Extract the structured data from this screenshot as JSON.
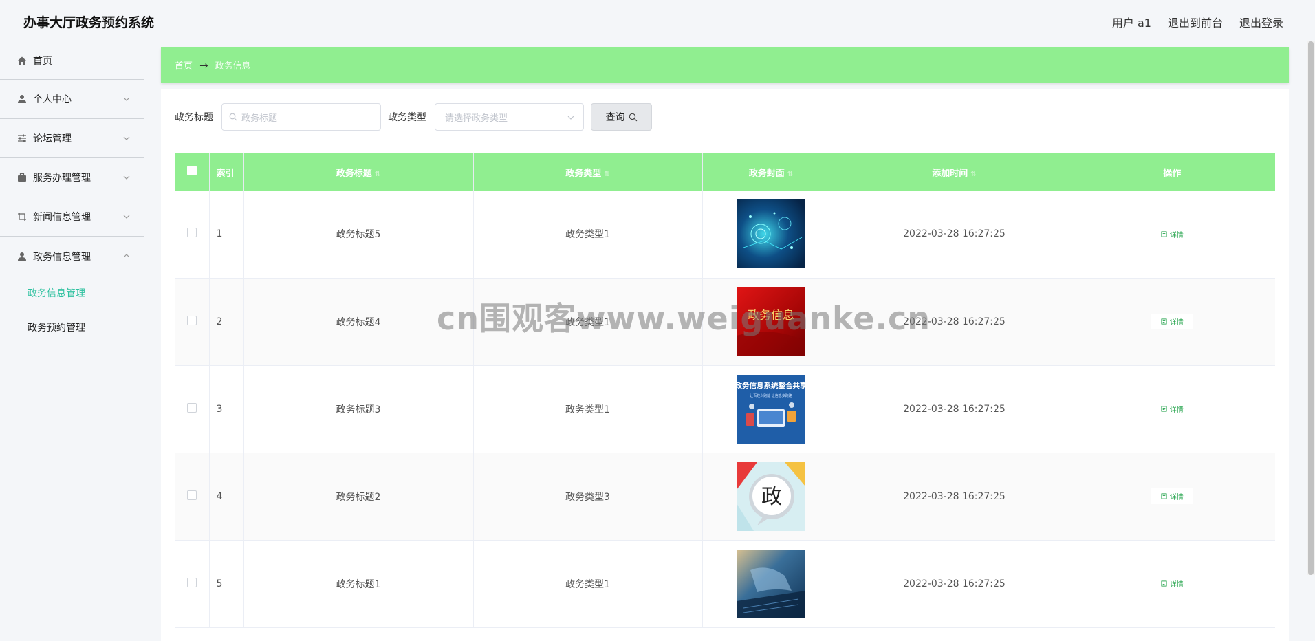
{
  "app": {
    "title": "办事大厅政务预约系统"
  },
  "topbar": {
    "user": "用户 a1",
    "back_front": "退出到前台",
    "logout": "退出登录"
  },
  "sidebar": {
    "home": "首页",
    "items": [
      {
        "label": "个人中心",
        "icon": "person-icon"
      },
      {
        "label": "论坛管理",
        "icon": "sliders-icon"
      },
      {
        "label": "服务办理管理",
        "icon": "briefcase-icon"
      },
      {
        "label": "新闻信息管理",
        "icon": "crop-icon"
      },
      {
        "label": "政务信息管理",
        "icon": "person-icon"
      }
    ],
    "submenu": [
      {
        "label": "政务信息管理",
        "active": true
      },
      {
        "label": "政务预约管理",
        "active": false
      }
    ],
    "active_color": "#2fc1a0"
  },
  "breadcrumb": {
    "home": "首页",
    "arrow": "→",
    "current": "政务信息"
  },
  "search": {
    "title_label": "政务标题",
    "title_placeholder": "政务标题",
    "type_label": "政务类型",
    "type_placeholder": "请选择政务类型",
    "query_button": "查询"
  },
  "table": {
    "header_color": "#90ee90",
    "columns": [
      "索引",
      "政务标题",
      "政务类型",
      "政务封面",
      "添加时间",
      "操作"
    ],
    "action_label": "详情",
    "rows": [
      {
        "index": "1",
        "title": "政务标题5",
        "type": "政务类型1",
        "cover": "tech-network",
        "time": "2022-03-28 16:27:25"
      },
      {
        "index": "2",
        "title": "政务标题4",
        "type": "政务类型1",
        "cover": "red-banner",
        "time": "2022-03-28 16:27:25"
      },
      {
        "index": "3",
        "title": "政务标题3",
        "type": "政务类型1",
        "cover": "blue-poster",
        "time": "2022-03-28 16:27:25"
      },
      {
        "index": "4",
        "title": "政务标题2",
        "type": "政务类型3",
        "cover": "speech-bubble",
        "time": "2022-03-28 16:27:25"
      },
      {
        "index": "5",
        "title": "政务标题1",
        "type": "政务类型1",
        "cover": "keyboard-hands",
        "time": "2022-03-28 16:27:25"
      }
    ]
  },
  "covers": {
    "red_text": "政务信息",
    "blue_title": "政务信息系统整合共享",
    "blue_sub": "让百姓少跑腿 让信息多跑路",
    "bubble_char": "政"
  },
  "watermark": "cn围观客www.weiguanke.cn"
}
